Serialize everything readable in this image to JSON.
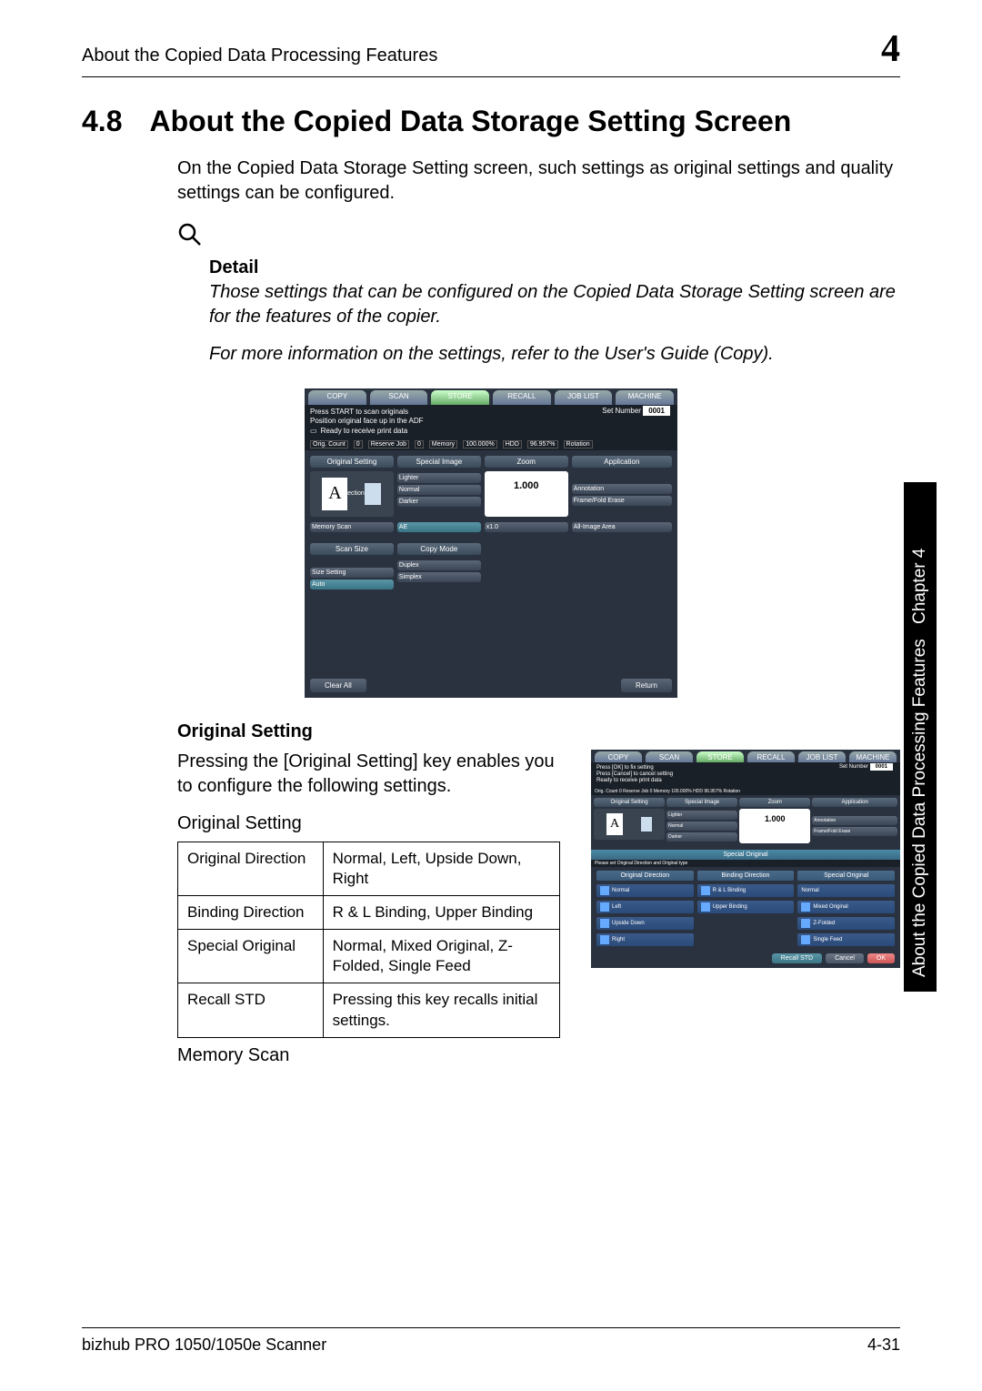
{
  "header": {
    "running_title": "About the Copied Data Processing Features",
    "chapter_number": "4"
  },
  "section": {
    "number": "4.8",
    "title": "About the Copied Data Storage Setting Screen",
    "intro": "On the Copied Data Storage Setting screen, such settings as original settings and quality settings can be configured."
  },
  "detail_block": {
    "label": "Detail",
    "p1": "Those settings that can be configured on the Copied Data Storage Setting screen are for the features of the copier.",
    "p2": "For more information on the settings, refer to the User's Guide (Copy)."
  },
  "screenshot1": {
    "tabs": [
      "COPY",
      "SCAN",
      "STORE",
      "RECALL",
      "JOB LIST",
      "MACHINE"
    ],
    "msg1": "Press START to scan originals",
    "msg2": "Position original face up in the ADF",
    "msg3": "Ready to receive print data",
    "set_number_label": "Set Number",
    "set_number_value": "0001",
    "status": {
      "orig_count": "Orig. Count",
      "orig_val": "0",
      "reserve": "Reserve Job",
      "reserve_val": "0",
      "memory": "Memory",
      "memory_val": "100.000%",
      "hdd": "HDD",
      "hdd_val": "96.957%",
      "rotation": "Rotation"
    },
    "cols": {
      "original_setting": "Original Setting",
      "special_image": "Special Image",
      "zoom": "Zoom",
      "application": "Application"
    },
    "direction": {
      "label": "Direction",
      "a": "A"
    },
    "special_image_opts": {
      "lighter": "Lighter",
      "normal": "Normal",
      "darker": "Darker"
    },
    "memory_scan": "Memory Scan",
    "ae": "AE",
    "zoom_val": "1.000",
    "zoom_mult": "x1.0",
    "annotation": "Annotation",
    "frame_fold": "Frame/Fold Erase",
    "all_image": "All-Image Area",
    "scan_size": "Scan Size",
    "copy_mode": "Copy Mode",
    "size_setting": "Size Setting",
    "auto": "Auto",
    "duplex": "Duplex",
    "simplex": "Simplex",
    "clear_all": "Clear All",
    "return": "Return"
  },
  "original_setting_section": {
    "heading": "Original Setting",
    "para": "Pressing the [Original Setting] key enables you to configure the following settings.",
    "sub": "Original Setting",
    "table": [
      {
        "k": "Original Direction",
        "v": "Normal, Left, Upside Down, Right"
      },
      {
        "k": "Binding Direction",
        "v": "R & L Binding, Upper Binding"
      },
      {
        "k": "Special Original",
        "v": "Normal, Mixed Original, Z-Folded, Single Feed"
      },
      {
        "k": "Recall STD",
        "v": "Pressing this key recalls initial settings."
      }
    ],
    "memory_scan_label": "Memory Scan"
  },
  "screenshot2": {
    "tabs": [
      "COPY",
      "SCAN",
      "STORE",
      "RECALL",
      "JOB LIST",
      "MACHINE"
    ],
    "msg1": "Press [OK] to fix setting",
    "msg2": "Press [Cancel] to cancel setting",
    "msg3": "Ready to receive print data",
    "set_number_label": "Set Number",
    "set_number_value": "0001",
    "status_row": "Orig. Count 0 Reserve Job 0 Memory 100.000% HDD 96.957% Rotation",
    "cols": {
      "original_setting": "Original Setting",
      "special_image": "Special Image",
      "zoom": "Zoom",
      "application": "Application"
    },
    "direction_label": "Direction",
    "a": "A",
    "lighter": "Lighter",
    "normal": "Normal",
    "darker": "Darker",
    "zoom_val": "1.000",
    "annotation": "Annotation",
    "frame_fold": "Frame/Fold Erase",
    "overlay_title": "Special Original",
    "overlay_subtitle": "Please set Original Direction and Original type",
    "col_heads": {
      "orig_dir": "Original Direction",
      "bind_dir": "Binding Direction",
      "special": "Special Original"
    },
    "orig_dir_opts": [
      "Normal",
      "Left",
      "Upside Down",
      "Right"
    ],
    "bind_dir_opts": [
      "R & L Binding",
      "Upper Binding"
    ],
    "special_opts": [
      "Normal",
      "Mixed Original",
      "Z-Folded",
      "Single Feed"
    ],
    "recall_std": "Recall STD",
    "cancel": "Cancel",
    "ok": "OK"
  },
  "side_tab": {
    "chapter": "Chapter 4",
    "title": "About the Copied Data Processing Features"
  },
  "footer": {
    "left": "bizhub PRO 1050/1050e Scanner",
    "right": "4-31"
  }
}
